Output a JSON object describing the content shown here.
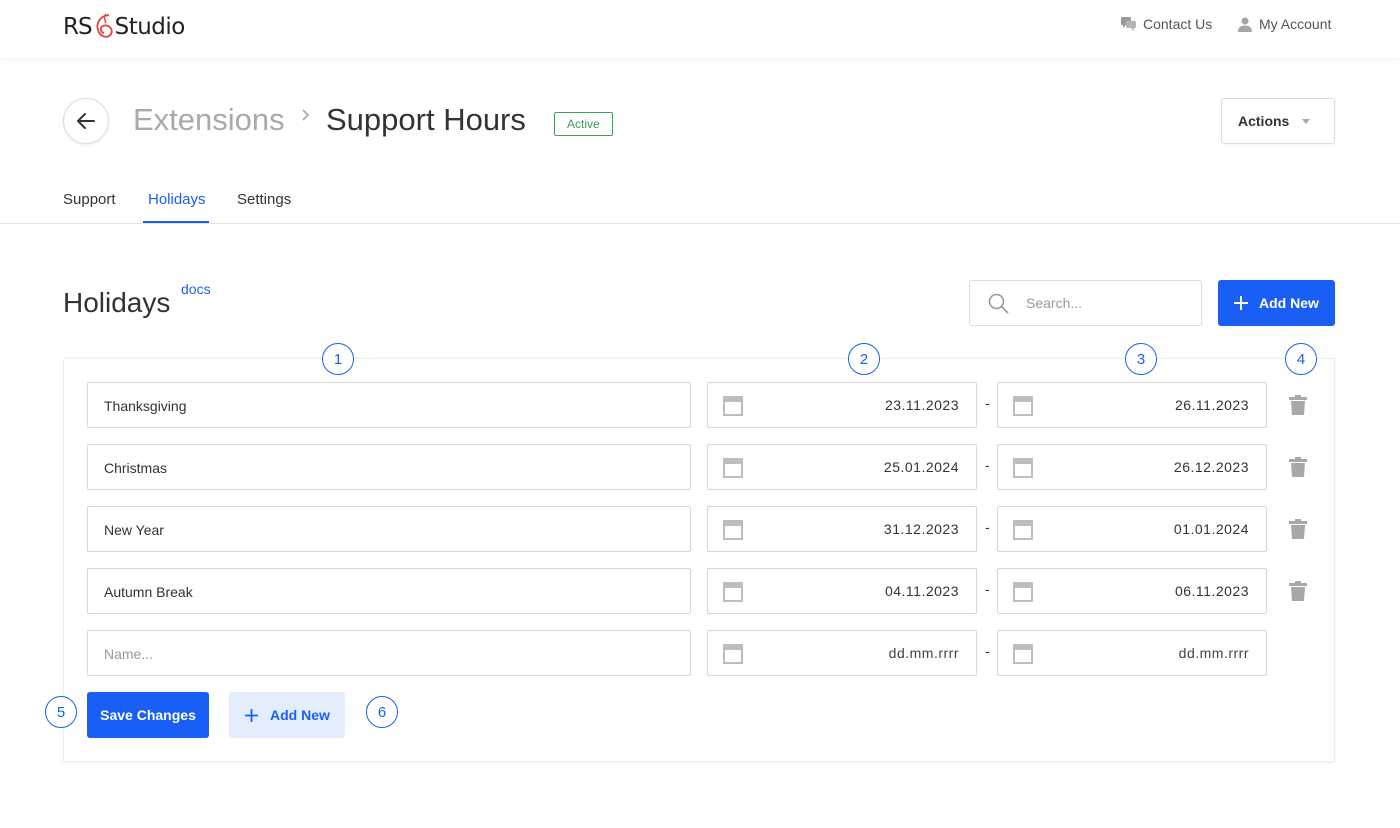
{
  "topbar": {
    "logo_left": "RS",
    "logo_right": "Studio",
    "contact_label": "Contact Us",
    "account_label": "My Account"
  },
  "breadcrumb": {
    "parent": "Extensions",
    "current": "Support Hours",
    "status": "Active"
  },
  "actions_label": "Actions",
  "tabs": [
    {
      "label": "Support",
      "active": false
    },
    {
      "label": "Holidays",
      "active": true
    },
    {
      "label": "Settings",
      "active": false
    }
  ],
  "section": {
    "title": "Holidays",
    "docs_label": "docs",
    "search_placeholder": "Search...",
    "add_new_label": "Add New"
  },
  "holidays": [
    {
      "name": "Thanksgiving",
      "start": "23.11.2023",
      "end": "26.11.2023"
    },
    {
      "name": "Christmas",
      "start": "25.01.2024",
      "end": "26.12.2023"
    },
    {
      "name": "New Year",
      "start": "31.12.2023",
      "end": "01.01.2024"
    },
    {
      "name": "Autumn Break",
      "start": "04.11.2023",
      "end": "06.11.2023"
    }
  ],
  "new_row": {
    "name_placeholder": "Name...",
    "start_placeholder": "dd.mm.rrrr",
    "end_placeholder": "dd.mm.rrrr"
  },
  "date_separator": "-",
  "footer": {
    "save_label": "Save Changes",
    "add_new_label": "Add New"
  },
  "markers": [
    "1",
    "2",
    "3",
    "4",
    "5",
    "6"
  ],
  "colors": {
    "accent": "#1a5ff5",
    "status_green": "#3a9a55",
    "add_new_light": "#e3edfc"
  }
}
